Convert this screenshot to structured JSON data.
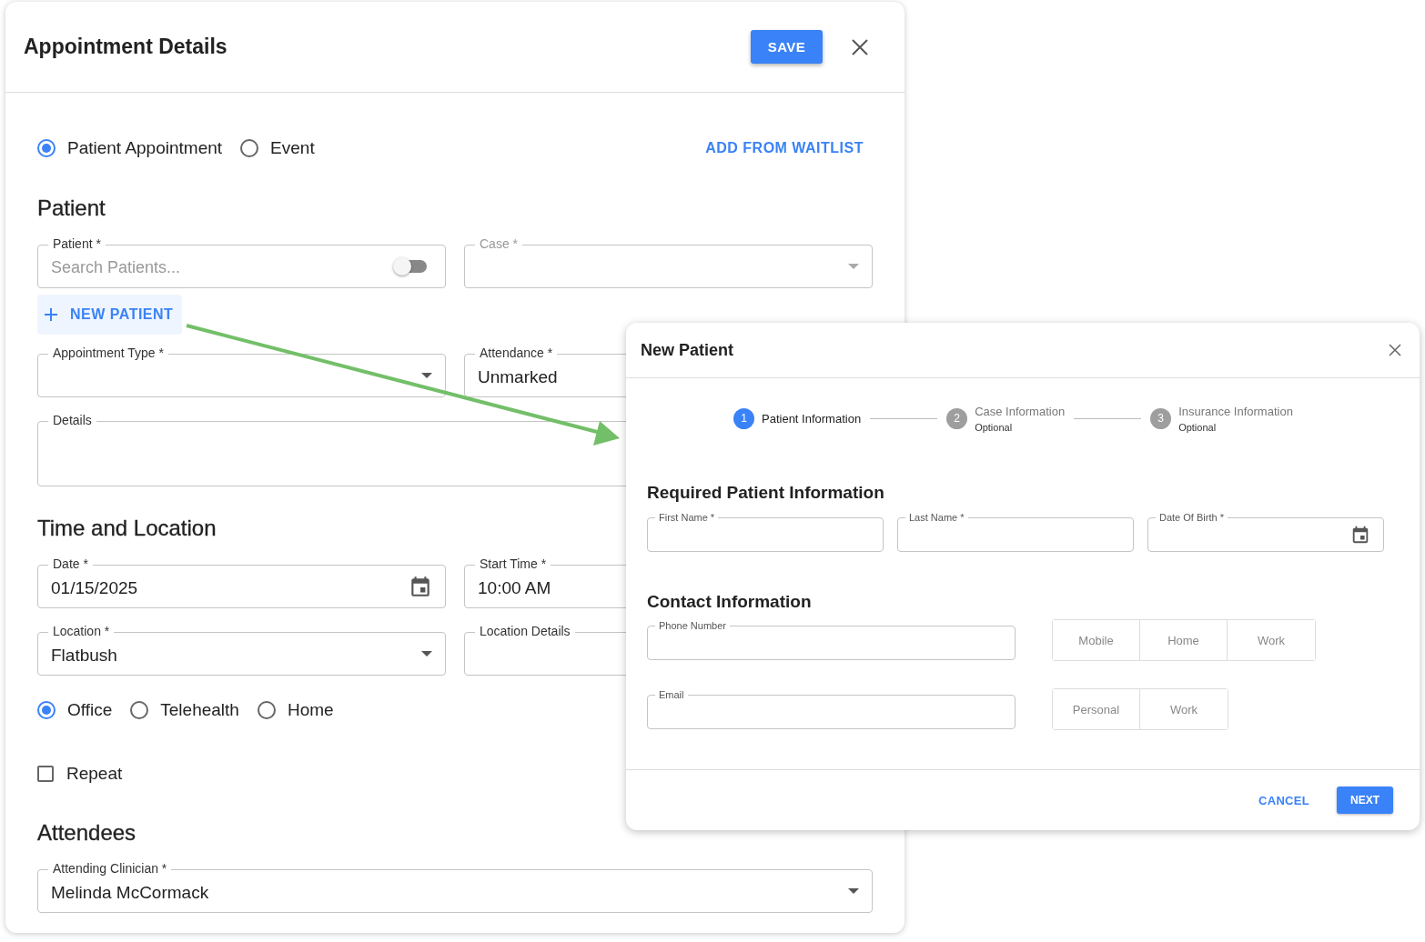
{
  "appointment_dialog": {
    "title": "Appointment Details",
    "save_button": "SAVE",
    "appointment_kinds": [
      {
        "label": "Patient Appointment",
        "selected": true
      },
      {
        "label": "Event",
        "selected": false
      }
    ],
    "add_from_waitlist": "ADD FROM WAITLIST",
    "patient_section": {
      "heading": "Patient",
      "row_1": [
        {
          "kind": "search",
          "label": "Patient *",
          "placeholder": "Search Patients...",
          "toggle_on": false,
          "disabled": false
        },
        {
          "kind": "select",
          "label": "Case *",
          "disabled": true
        }
      ],
      "new_patient_button": "NEW PATIENT",
      "row_2": [
        {
          "kind": "select",
          "label": "Appointment Type *",
          "disabled": false
        },
        {
          "kind": "text",
          "label": "Attendance *",
          "value": "Unmarked",
          "disabled": false
        }
      ],
      "row_3": [
        {
          "kind": "textarea",
          "label": "Details",
          "disabled": false
        }
      ]
    },
    "time_section": {
      "heading": "Time and Location",
      "row_1": [
        {
          "kind": "date",
          "label": "Date *",
          "value": "01/15/2025",
          "disabled": false
        },
        {
          "kind": "time",
          "label": "Start Time *",
          "value": "10:00 AM",
          "disabled": false
        }
      ],
      "row_2": [
        {
          "kind": "select",
          "label": "Location *",
          "value": "Flatbush",
          "disabled": false
        },
        {
          "kind": "text",
          "label": "Location Details",
          "disabled": false
        }
      ],
      "location_types": [
        {
          "label": "Office",
          "selected": true
        },
        {
          "label": "Telehealth",
          "selected": false
        },
        {
          "label": "Home",
          "selected": false
        }
      ],
      "repeat": {
        "label": "Repeat",
        "checked": false
      }
    },
    "attendees_section": {
      "heading": "Attendees",
      "row_1": [
        {
          "kind": "select",
          "label": "Attending Clinician *",
          "value": "Melinda McCormack",
          "disabled": false
        }
      ]
    }
  },
  "new_patient_dialog": {
    "title": "New Patient",
    "steps": [
      {
        "number": "1",
        "label": "Patient Information",
        "selected": true
      },
      {
        "number": "2",
        "label": "Case Information",
        "sublabel": "Optional",
        "selected": false
      },
      {
        "number": "3",
        "label": "Insurance Information",
        "sublabel": "Optional",
        "selected": false
      }
    ],
    "required_heading": "Required Patient Information",
    "required_fields": [
      {
        "kind": "text",
        "label": "First Name *"
      },
      {
        "kind": "text",
        "label": "Last Name *"
      },
      {
        "kind": "date",
        "label": "Date Of Birth *"
      }
    ],
    "contact_heading": "Contact Information",
    "contact_rows": [
      {
        "field": {
          "label": "Phone Number"
        },
        "options": [
          "Mobile",
          "Home",
          "Work"
        ]
      },
      {
        "field": {
          "label": "Email"
        },
        "options": [
          "Personal",
          "Work"
        ]
      }
    ],
    "cancel_button": "CANCEL",
    "next_button": "NEXT"
  }
}
